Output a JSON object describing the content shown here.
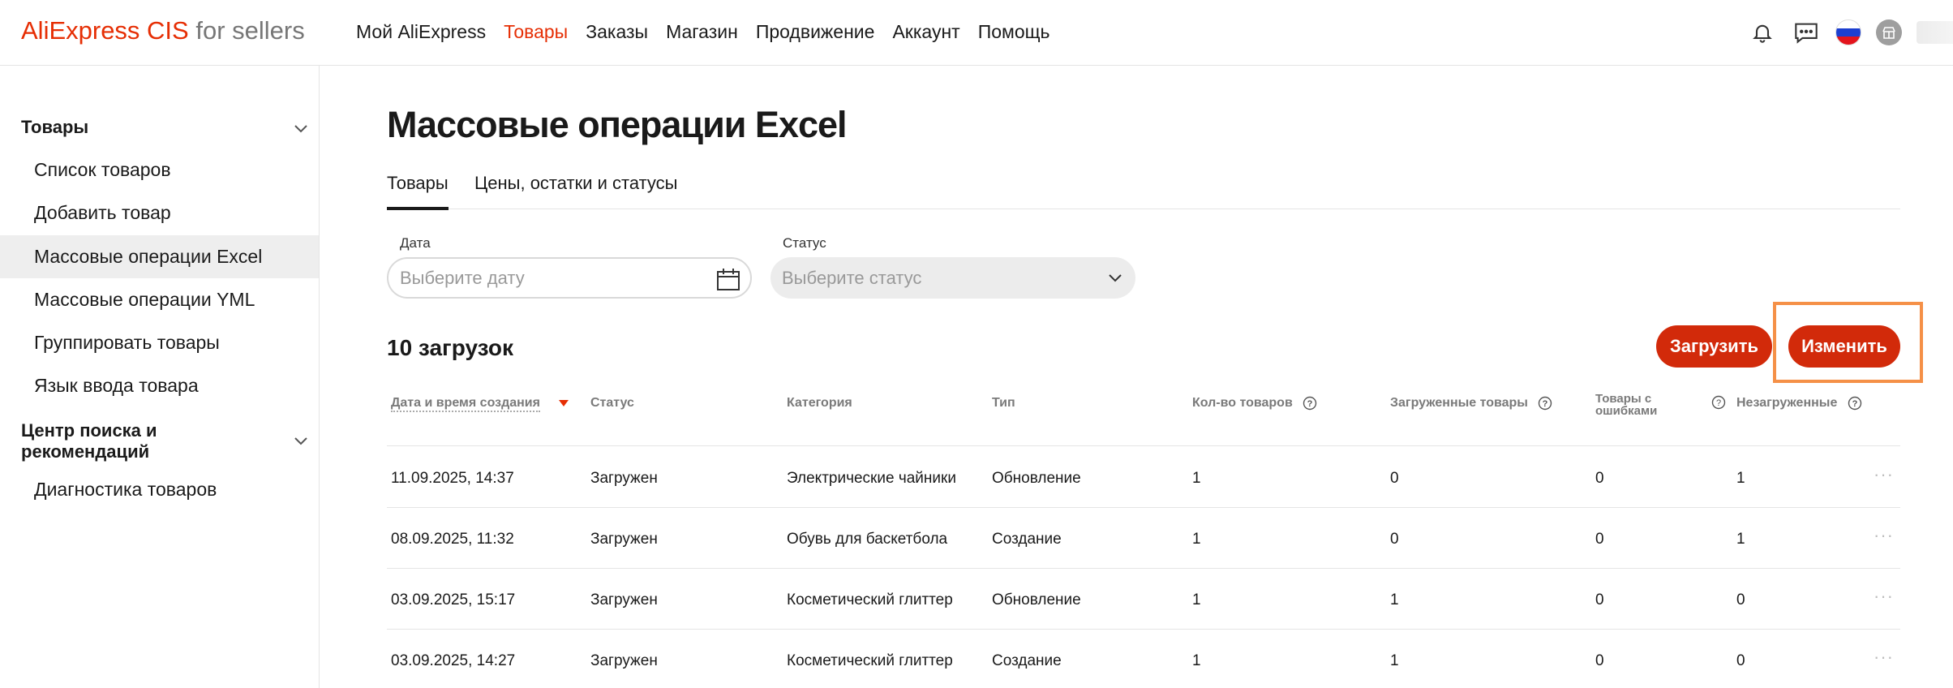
{
  "logo": {
    "brand": "AliExpress CIS",
    "suffix": " for sellers"
  },
  "topnav": [
    "Мой AliExpress",
    "Товары",
    "Заказы",
    "Магазин",
    "Продвижение",
    "Аккаунт",
    "Помощь"
  ],
  "topnav_active": "Товары",
  "top_icons": [
    "bell-icon",
    "message-icon",
    "russia-flag-icon",
    "avatar"
  ],
  "sidebar": {
    "section1": "Товары",
    "items1": [
      "Список товаров",
      "Добавить товар",
      "Массовые операции Excel",
      "Массовые операции YML",
      "Группировать товары",
      "Язык ввода товара"
    ],
    "active_item": "Массовые операции Excel",
    "section2": "Центр поиска и рекомендаций",
    "items2": [
      "Диагностика товаров"
    ]
  },
  "page_title": "Массовые операции Excel",
  "tabs": [
    "Товары",
    "Цены, остатки и статусы"
  ],
  "filters": {
    "date_label": "Дата",
    "date_placeholder": "Выберите дату",
    "status_label": "Статус",
    "status_placeholder": "Выберите статус"
  },
  "uploads_count": "10 загрузок",
  "buttons": {
    "upload": "Загрузить",
    "edit": "Изменить"
  },
  "colors": {
    "accent": "#e62e04",
    "button": "#d22a0a",
    "highlight": "#f59047"
  },
  "table": {
    "columns": [
      "Дата и время создания",
      "Статус",
      "Категория",
      "Тип",
      "Кол-во товаров",
      "Загруженные товары",
      "Товары с ошибками",
      "Незагруженные"
    ],
    "rows": [
      [
        "11.09.2025, 14:37",
        "Загружен",
        "Электрические чайники",
        "Обновление",
        "1",
        "0",
        "0",
        "1"
      ],
      [
        "08.09.2025, 11:32",
        "Загружен",
        "Обувь для баскетбола",
        "Создание",
        "1",
        "0",
        "0",
        "1"
      ],
      [
        "03.09.2025, 15:17",
        "Загружен",
        "Косметический глиттер",
        "Обновление",
        "1",
        "1",
        "0",
        "0"
      ],
      [
        "03.09.2025, 14:27",
        "Загружен",
        "Косметический глиттер",
        "Создание",
        "1",
        "1",
        "0",
        "0"
      ]
    ],
    "row_menu": "···"
  }
}
